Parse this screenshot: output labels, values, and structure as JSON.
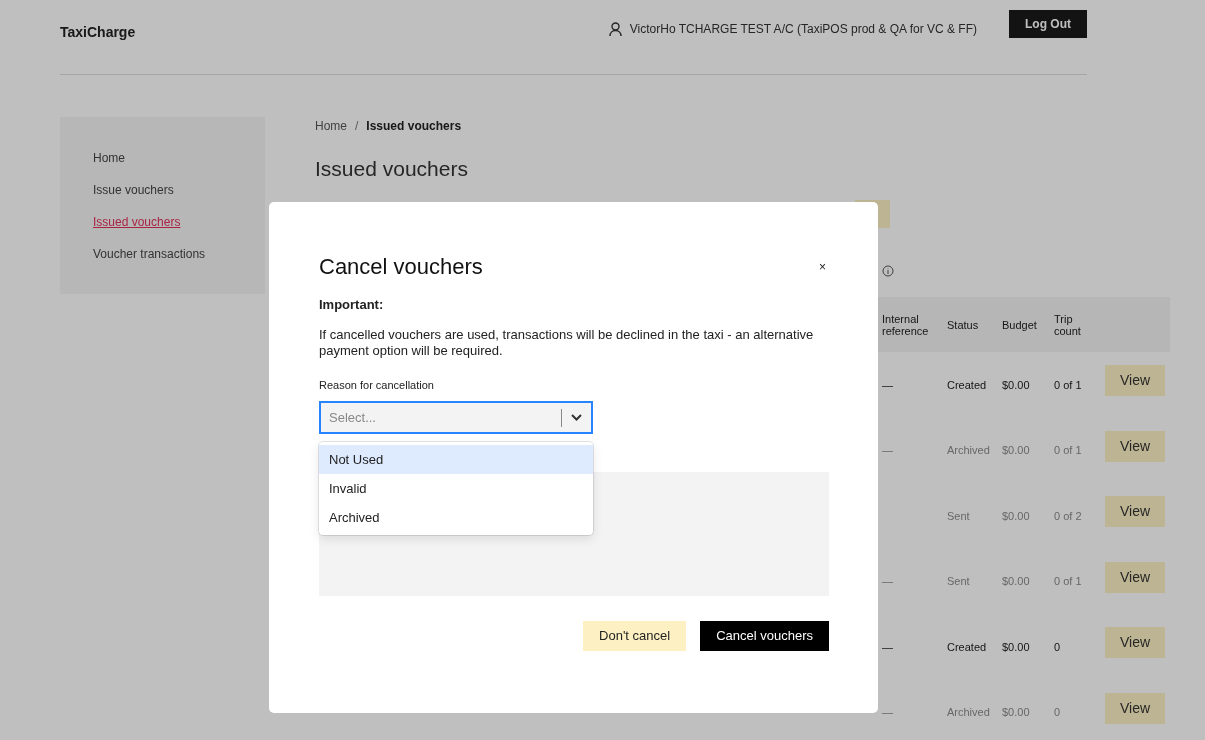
{
  "header": {
    "brand": "TaxiCharge",
    "user": "VictorHo TCHARGE TEST A/C (TaxiPOS prod & QA for VC & FF)",
    "logout": "Log Out"
  },
  "sidebar": {
    "items": [
      {
        "label": "Home",
        "selected": false
      },
      {
        "label": "Issue vouchers",
        "selected": false
      },
      {
        "label": "Issued vouchers",
        "selected": true
      },
      {
        "label": "Voucher transactions",
        "selected": false
      }
    ]
  },
  "breadcrumb": [
    {
      "label": "Home",
      "selected": false
    },
    {
      "label": "Issued vouchers",
      "selected": true
    }
  ],
  "breadcrumb_separator": "/",
  "page_title": "Issued vouchers",
  "table": {
    "columns": [
      "Internal reference",
      "Status",
      "Budget",
      "Trip count"
    ],
    "rows": [
      {
        "cells": [
          "—",
          "Created",
          "$0.00",
          "0 of 1"
        ],
        "muted": false,
        "action": "View"
      },
      {
        "cells": [
          "—",
          "Archived",
          "$0.00",
          "0 of 1"
        ],
        "muted": true,
        "action": "View"
      },
      {
        "cells": [
          "",
          "Sent",
          "$0.00",
          "0 of 2"
        ],
        "muted": true,
        "action": "View"
      },
      {
        "cells": [
          "—",
          "Sent",
          "$0.00",
          "0 of 1"
        ],
        "muted": true,
        "action": "View"
      },
      {
        "cells": [
          "—",
          "Created",
          "$0.00",
          "0"
        ],
        "muted": false,
        "action": "View"
      },
      {
        "cells": [
          "—",
          "Archived",
          "$0.00",
          "0"
        ],
        "muted": true,
        "action": "View"
      }
    ]
  },
  "dialog": {
    "title": "Cancel vouchers",
    "close": "×",
    "important": "Important:",
    "message": "If cancelled vouchers are used, transactions will be declined in the taxi - an alternative payment option will be required.",
    "reason_label": "Reason for cancellation",
    "reason_placeholder": "Select...",
    "options": [
      {
        "label": "Not Used",
        "selected": true
      },
      {
        "label": "Invalid",
        "selected": false
      },
      {
        "label": "Archived",
        "selected": false
      }
    ],
    "buttons": [
      {
        "label": "Don't cancel",
        "kind": "secondary"
      },
      {
        "label": "Cancel vouchers",
        "kind": "primary"
      }
    ]
  }
}
